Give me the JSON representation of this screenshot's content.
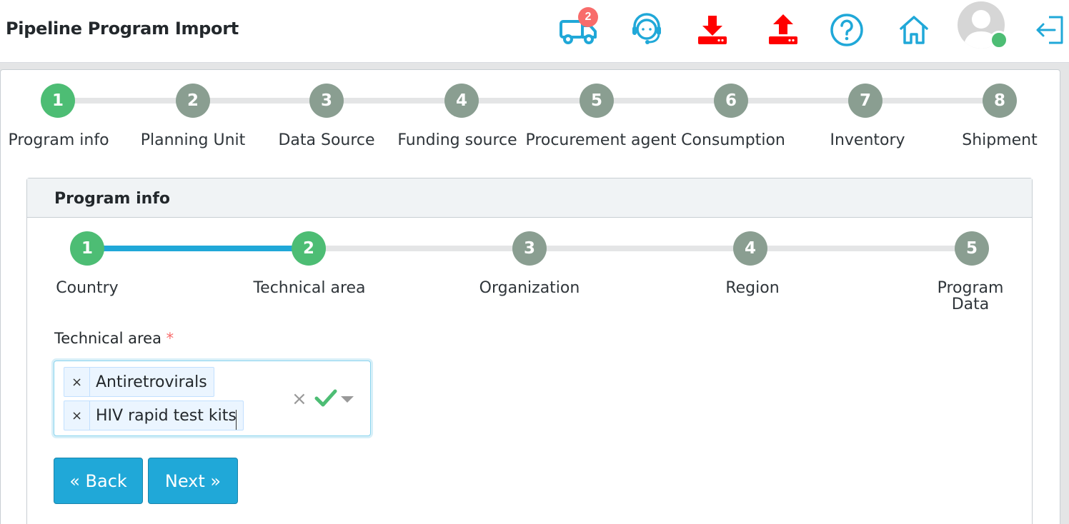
{
  "header": {
    "title": "Pipeline Program Import",
    "shipment_badge_count": "2",
    "icons": [
      "truck-icon",
      "support-agent-icon",
      "download-icon",
      "upload-icon",
      "help-icon",
      "home-icon",
      "avatar",
      "logout-icon"
    ],
    "colors": {
      "primary": "#20a8d8",
      "danger": "#ff0000",
      "success": "#4dbd74"
    }
  },
  "main_stepper": {
    "steps": [
      {
        "number": "1",
        "label": "Program info",
        "status": "done"
      },
      {
        "number": "2",
        "label": "Planning Unit",
        "status": "pending"
      },
      {
        "number": "3",
        "label": "Data Source",
        "status": "pending"
      },
      {
        "number": "4",
        "label": "Funding source",
        "status": "pending"
      },
      {
        "number": "5",
        "label": "Procurement agent",
        "status": "pending"
      },
      {
        "number": "6",
        "label": "Consumption",
        "status": "pending"
      },
      {
        "number": "7",
        "label": "Inventory",
        "status": "pending"
      },
      {
        "number": "8",
        "label": "Shipment",
        "status": "pending"
      }
    ]
  },
  "program_info": {
    "title": "Program info",
    "sub_stepper": {
      "steps": [
        {
          "number": "1",
          "label": "Country",
          "status": "done"
        },
        {
          "number": "2",
          "label": "Technical area",
          "status": "done"
        },
        {
          "number": "3",
          "label": "Organization",
          "status": "pending"
        },
        {
          "number": "4",
          "label": "Region",
          "status": "pending"
        },
        {
          "number": "5",
          "label_line1": "Program",
          "label_line2": "Data",
          "status": "pending"
        }
      ]
    },
    "field": {
      "label": "Technical area",
      "required_mark": "*",
      "selected": [
        "Antiretrovirals",
        "HIV rapid test kits"
      ],
      "chip_remove": "×",
      "clear": "×"
    },
    "buttons": {
      "back": "« Back",
      "next": "Next »"
    }
  }
}
